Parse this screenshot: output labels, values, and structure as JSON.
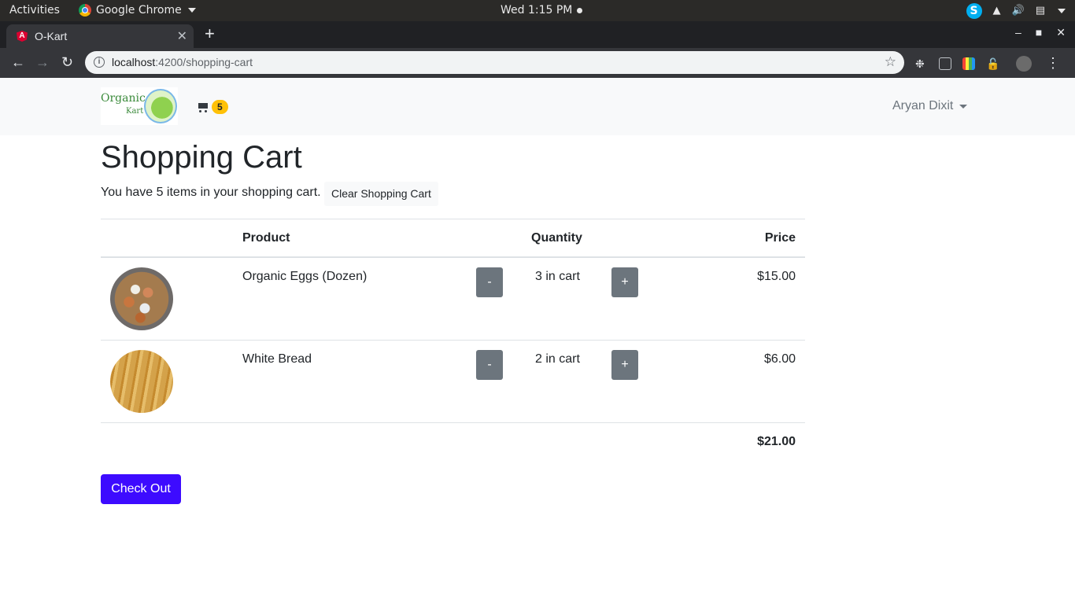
{
  "os": {
    "activities": "Activities",
    "app_name": "Google Chrome",
    "clock": "Wed  1:15 PM",
    "tray_icons": [
      "skype-icon",
      "network-icon",
      "volume-icon",
      "clipboard-icon",
      "caret-down-icon"
    ]
  },
  "browser": {
    "tab_title": "O-Kart",
    "url_host": "localhost",
    "url_path": ":4200/shopping-cart",
    "accent": "#3d0bff"
  },
  "navbar": {
    "brand_line1": "Organic",
    "brand_line2": "Kart",
    "cart_count": "5",
    "user_name": "Aryan Dixit"
  },
  "page": {
    "title": "Shopping Cart",
    "summary": "You have 5 items in your shopping cart.",
    "clear_label": "Clear Shopping Cart",
    "columns": {
      "product": "Product",
      "quantity": "Quantity",
      "price": "Price"
    },
    "items": [
      {
        "name": "Organic Eggs (Dozen)",
        "minus": "-",
        "qty": "3 in cart",
        "plus": "+",
        "price": "$15.00",
        "image": "eggs-image"
      },
      {
        "name": "White Bread",
        "minus": "-",
        "qty": "2 in cart",
        "plus": "+",
        "price": "$6.00",
        "image": "bread-image"
      }
    ],
    "total": "$21.00",
    "checkout_label": "Check Out"
  }
}
